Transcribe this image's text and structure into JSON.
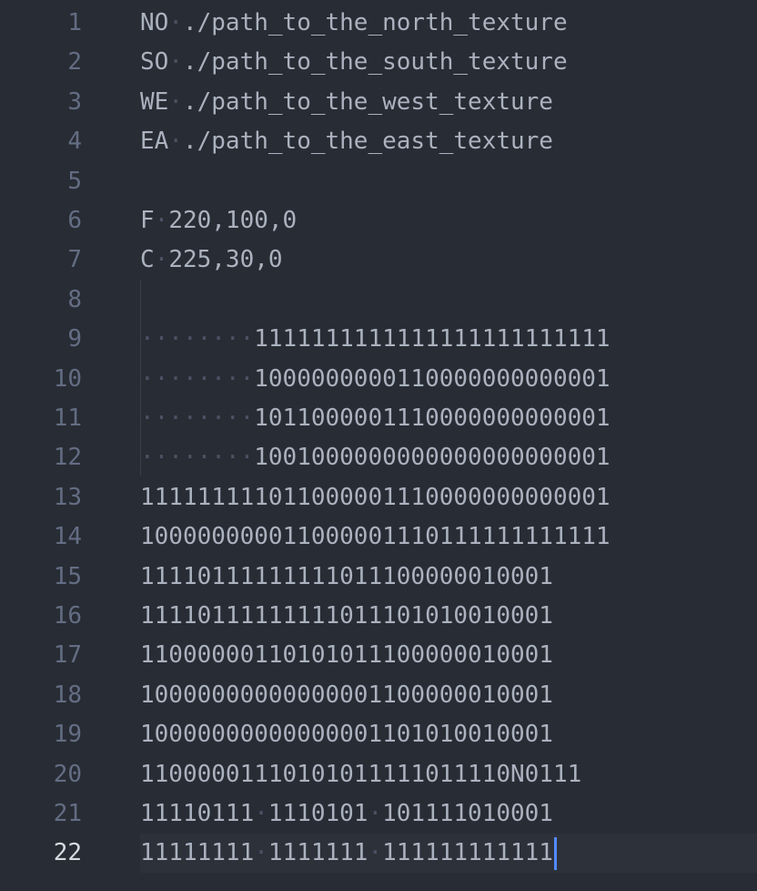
{
  "editor": {
    "active_line": 22,
    "lines": [
      {
        "num": "1",
        "parts": [
          {
            "t": "NO"
          },
          {
            "ws": "·"
          },
          {
            "t": "./path_to_the_north_texture"
          }
        ]
      },
      {
        "num": "2",
        "parts": [
          {
            "t": "SO"
          },
          {
            "ws": "·"
          },
          {
            "t": "./path_to_the_south_texture"
          }
        ]
      },
      {
        "num": "3",
        "parts": [
          {
            "t": "WE"
          },
          {
            "ws": "·"
          },
          {
            "t": "./path_to_the_west_texture"
          }
        ]
      },
      {
        "num": "4",
        "parts": [
          {
            "t": "EA"
          },
          {
            "ws": "·"
          },
          {
            "t": "./path_to_the_east_texture"
          }
        ]
      },
      {
        "num": "5",
        "parts": []
      },
      {
        "num": "6",
        "parts": [
          {
            "t": "F"
          },
          {
            "ws": "·"
          },
          {
            "t": "220,100,0"
          }
        ]
      },
      {
        "num": "7",
        "parts": [
          {
            "t": "C"
          },
          {
            "ws": "·"
          },
          {
            "t": "225,30,0"
          }
        ]
      },
      {
        "num": "8",
        "parts": []
      },
      {
        "num": "9",
        "parts": [
          {
            "ws": "········"
          },
          {
            "t": "1111111111111111111111111"
          }
        ]
      },
      {
        "num": "10",
        "parts": [
          {
            "ws": "········"
          },
          {
            "t": "1000000000110000000000001"
          }
        ]
      },
      {
        "num": "11",
        "parts": [
          {
            "ws": "········"
          },
          {
            "t": "1011000001110000000000001"
          }
        ]
      },
      {
        "num": "12",
        "parts": [
          {
            "ws": "········"
          },
          {
            "t": "1001000000000000000000001"
          }
        ]
      },
      {
        "num": "13",
        "parts": [
          {
            "t": "111111111011000001110000000000001"
          }
        ]
      },
      {
        "num": "14",
        "parts": [
          {
            "t": "100000000011000001110111111111111"
          }
        ]
      },
      {
        "num": "15",
        "parts": [
          {
            "t": "11110111111111011100000010001"
          }
        ]
      },
      {
        "num": "16",
        "parts": [
          {
            "t": "11110111111111011101010010001"
          }
        ]
      },
      {
        "num": "17",
        "parts": [
          {
            "t": "11000000110101011100000010001"
          }
        ]
      },
      {
        "num": "18",
        "parts": [
          {
            "t": "10000000000000001100000010001"
          }
        ]
      },
      {
        "num": "19",
        "parts": [
          {
            "t": "10000000000000001101010010001"
          }
        ]
      },
      {
        "num": "20",
        "parts": [
          {
            "t": "11000001110101011111011110N0111"
          }
        ]
      },
      {
        "num": "21",
        "parts": [
          {
            "t": "11110111"
          },
          {
            "ws": "·"
          },
          {
            "t": "1110101"
          },
          {
            "ws": "·"
          },
          {
            "t": "101111010001"
          }
        ]
      },
      {
        "num": "22",
        "parts": [
          {
            "t": "11111111"
          },
          {
            "ws": "·"
          },
          {
            "t": "1111111"
          },
          {
            "ws": "·"
          },
          {
            "t": "111111111111"
          }
        ]
      }
    ]
  }
}
